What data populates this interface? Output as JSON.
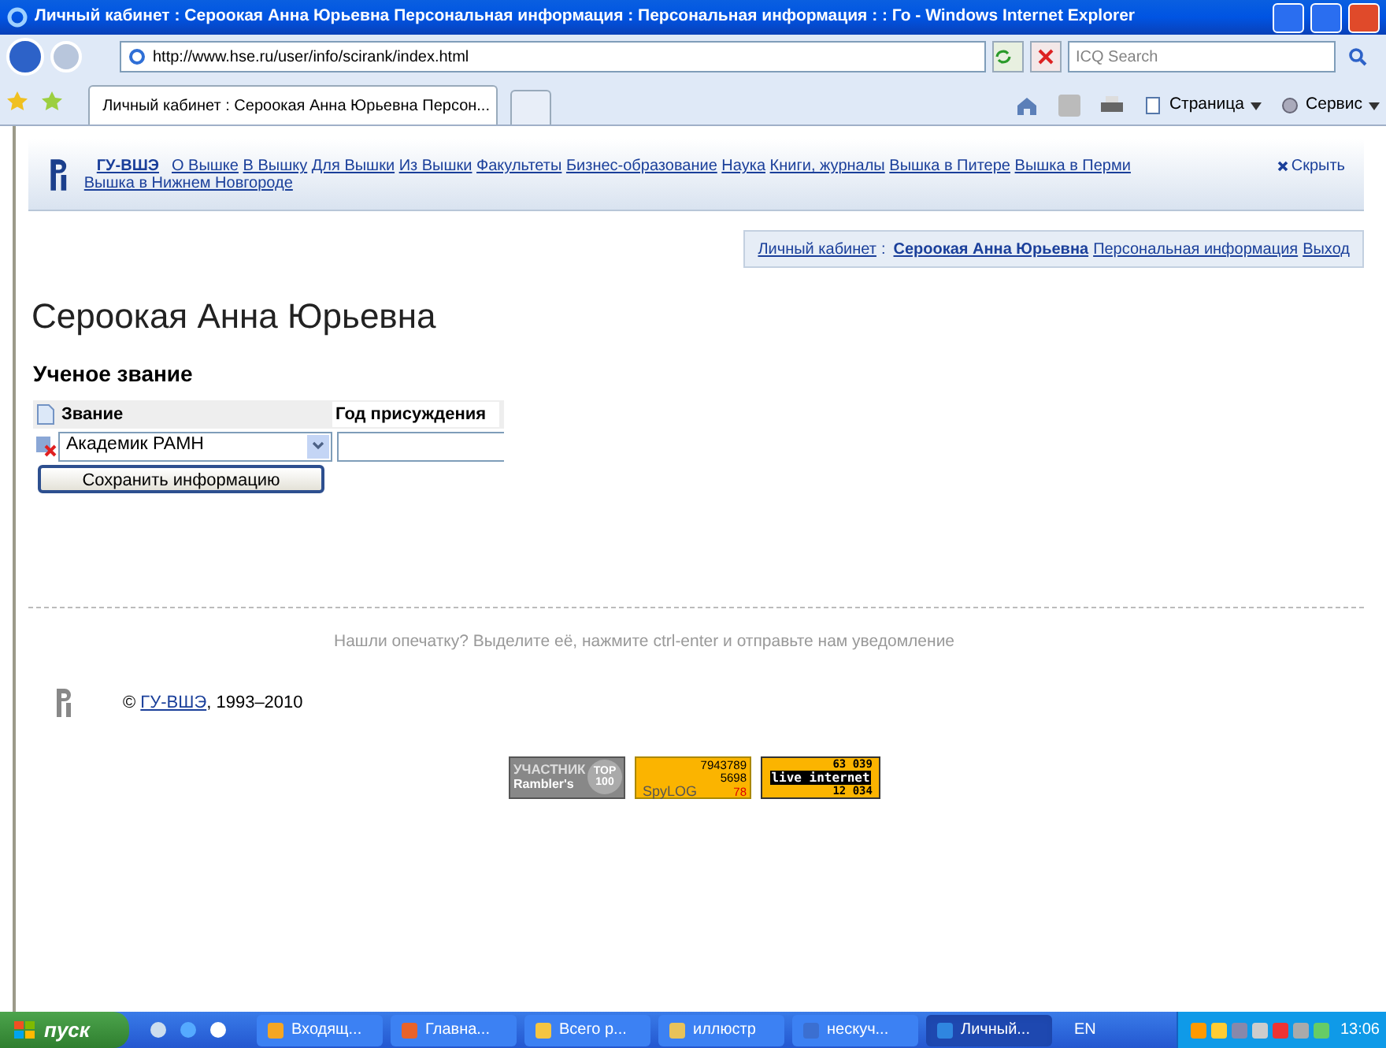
{
  "window": {
    "title": "Личный кабинет : Сероокая Анна Юрьевна Персональная информация : Персональная информация : : Го - Windows Internet Explorer"
  },
  "browser": {
    "address": "http://www.hse.ru/user/info/scirank/index.html",
    "search_placeholder": "ICQ Search",
    "tab": "Личный кабинет : Сероокая Анна Юрьевна Персон...",
    "commands": [
      "Страница",
      "Сервис"
    ]
  },
  "site_nav": {
    "home": "ГУ-ВШЭ",
    "links": [
      "О Вышке",
      "В Вышку",
      "Для Вышки",
      "Из Вышки",
      "Факультеты",
      "Бизнес-образование",
      "Наука",
      "Книги, журналы",
      "Вышка в Питере",
      "Вышка в Перми",
      "Вышка в Нижнем Новгороде"
    ],
    "hide": "Скрыть"
  },
  "user_bar": {
    "label": "Личный кабинет",
    "separator": ":",
    "name": "Сероокая Анна Юрьевна",
    "links": [
      "Персональная информация",
      "Выход"
    ]
  },
  "heading": "Сероокая Анна Юрьевна",
  "section": "Ученое звание",
  "table": {
    "columns": [
      "Звание",
      "Год присуждения"
    ],
    "rows": [
      {
        "title": "Академик РАМН",
        "year": ""
      }
    ]
  },
  "save_button": "Сохранить информацию",
  "footer": {
    "notice": "Нашли опечатку? Выделите её, нажмите ctrl-enter и отправьте нам уведомление",
    "copyright_prefix": "©",
    "copyright_link": "ГУ-ВШЭ",
    "copyright_suffix": ", 1993–2010"
  },
  "counters": [
    {
      "kind": "rambler",
      "lines": [
        "УЧАСТНИК",
        "Rambler's",
        "TOP",
        "100"
      ]
    },
    {
      "kind": "spylog",
      "lines": [
        "7943789",
        "5698",
        "SpyLOG",
        "78"
      ]
    },
    {
      "kind": "liveinternet",
      "lines": [
        "63 039",
        "live internet",
        "12 034"
      ]
    }
  ],
  "taskbar": {
    "start": "пуск",
    "tasks": [
      {
        "label": "Входящ...",
        "selected": false
      },
      {
        "label": "Главна...",
        "selected": false
      },
      {
        "label": "Всего р...",
        "selected": false
      },
      {
        "label": "иллюстр",
        "selected": false
      },
      {
        "label": "нескуч...",
        "selected": false
      },
      {
        "label": "Личный...",
        "selected": true
      }
    ],
    "lang": "EN",
    "time": "13:06"
  }
}
